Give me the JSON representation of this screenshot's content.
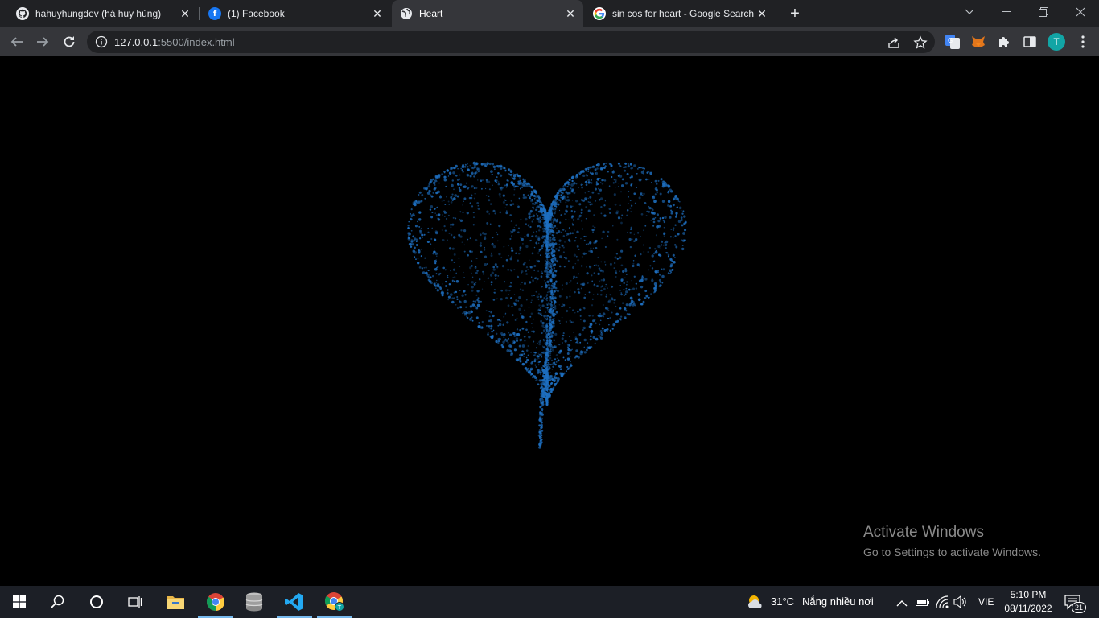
{
  "browser": {
    "tabs": [
      {
        "title": "hahuyhungdev (hà huy hùng)",
        "icon": "github-icon",
        "active": false
      },
      {
        "title": "(1) Facebook",
        "icon": "facebook-icon",
        "active": false
      },
      {
        "title": "Heart",
        "icon": "globe-icon",
        "active": true
      },
      {
        "title": "sin cos for heart - Google Search",
        "icon": "google-icon",
        "active": false
      }
    ],
    "url_host": "127.0.0.1",
    "url_rest": ":5500/index.html",
    "profile_initial": "T",
    "colors": {
      "tab_bar": "#202124",
      "toolbar": "#35363a",
      "omnibox": "#202124",
      "profile": "#12a5a5"
    }
  },
  "page": {
    "background": "#000000",
    "heart_color": "#1e6fc0",
    "watermark_title": "Activate Windows",
    "watermark_sub": "Go to Settings to activate Windows."
  },
  "taskbar": {
    "weather_temp": "31°C",
    "weather_desc": "Nắng nhiều nơi",
    "language": "VIE",
    "time": "5:10 PM",
    "date": "08/11/2022",
    "notification_count": "21",
    "apps": [
      "start-icon",
      "search-icon",
      "cortana-icon",
      "task-view-icon",
      "file-explorer-icon",
      "chrome-icon",
      "database-icon",
      "vscode-icon",
      "chrome-profile-icon"
    ]
  }
}
